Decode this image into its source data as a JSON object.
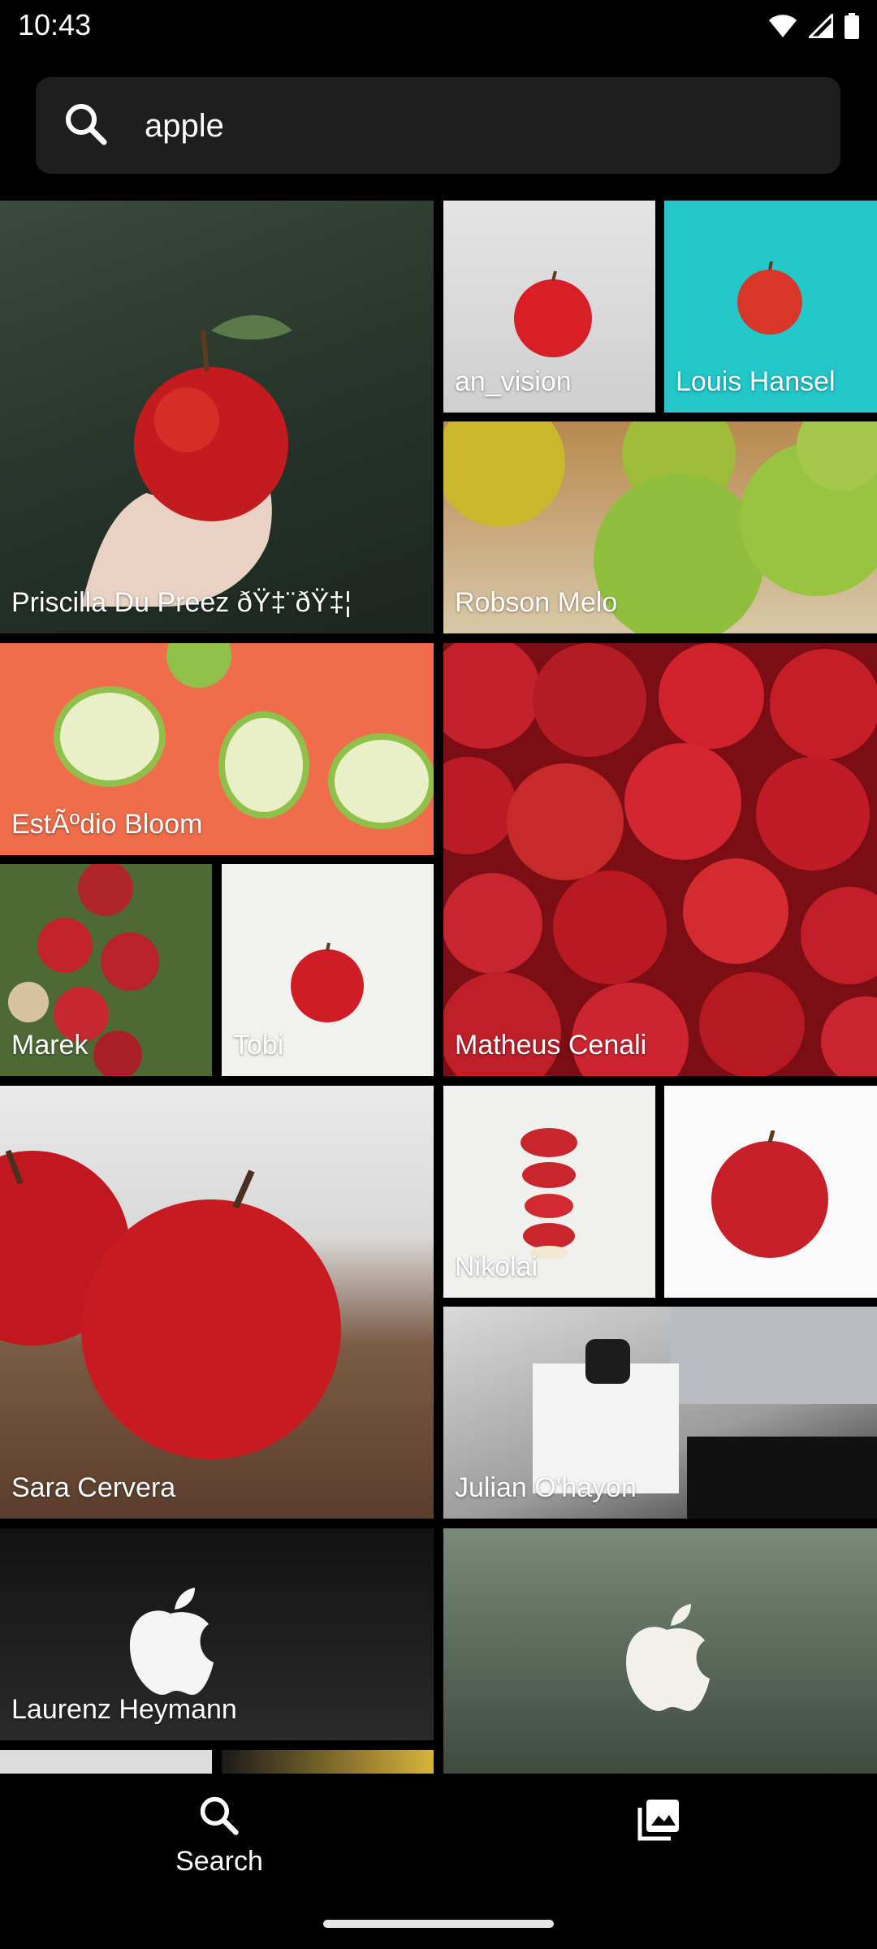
{
  "status_bar": {
    "time": "10:43",
    "icons": [
      "wifi-icon",
      "signal-icon",
      "battery-icon"
    ]
  },
  "search": {
    "value": "apple",
    "placeholder": "Search"
  },
  "photos": [
    {
      "credit": "Priscilla Du Preez ðŸ‡¨ðŸ‡¦"
    },
    {
      "credit": "an_vision"
    },
    {
      "credit": "Louis Hansel"
    },
    {
      "credit": "Robson Melo"
    },
    {
      "credit": "EstÃºdio Bloom"
    },
    {
      "credit": "Matheus Cenali"
    },
    {
      "credit": "Marek"
    },
    {
      "credit": "Tobi"
    },
    {
      "credit": "Sara Cervera"
    },
    {
      "credit": "Nikolai"
    },
    {
      "credit": ""
    },
    {
      "credit": "Julian O'hayon"
    },
    {
      "credit": "Laurenz Heymann"
    },
    {
      "credit": ""
    },
    {
      "credit": ""
    },
    {
      "credit": ""
    }
  ],
  "bottom_nav": {
    "search_label": "Search",
    "icons": [
      "search-icon",
      "gallery-icon"
    ]
  },
  "colors": {
    "background": "#000000",
    "search_bar": "#1e1e1e",
    "text": "#ffffff"
  }
}
